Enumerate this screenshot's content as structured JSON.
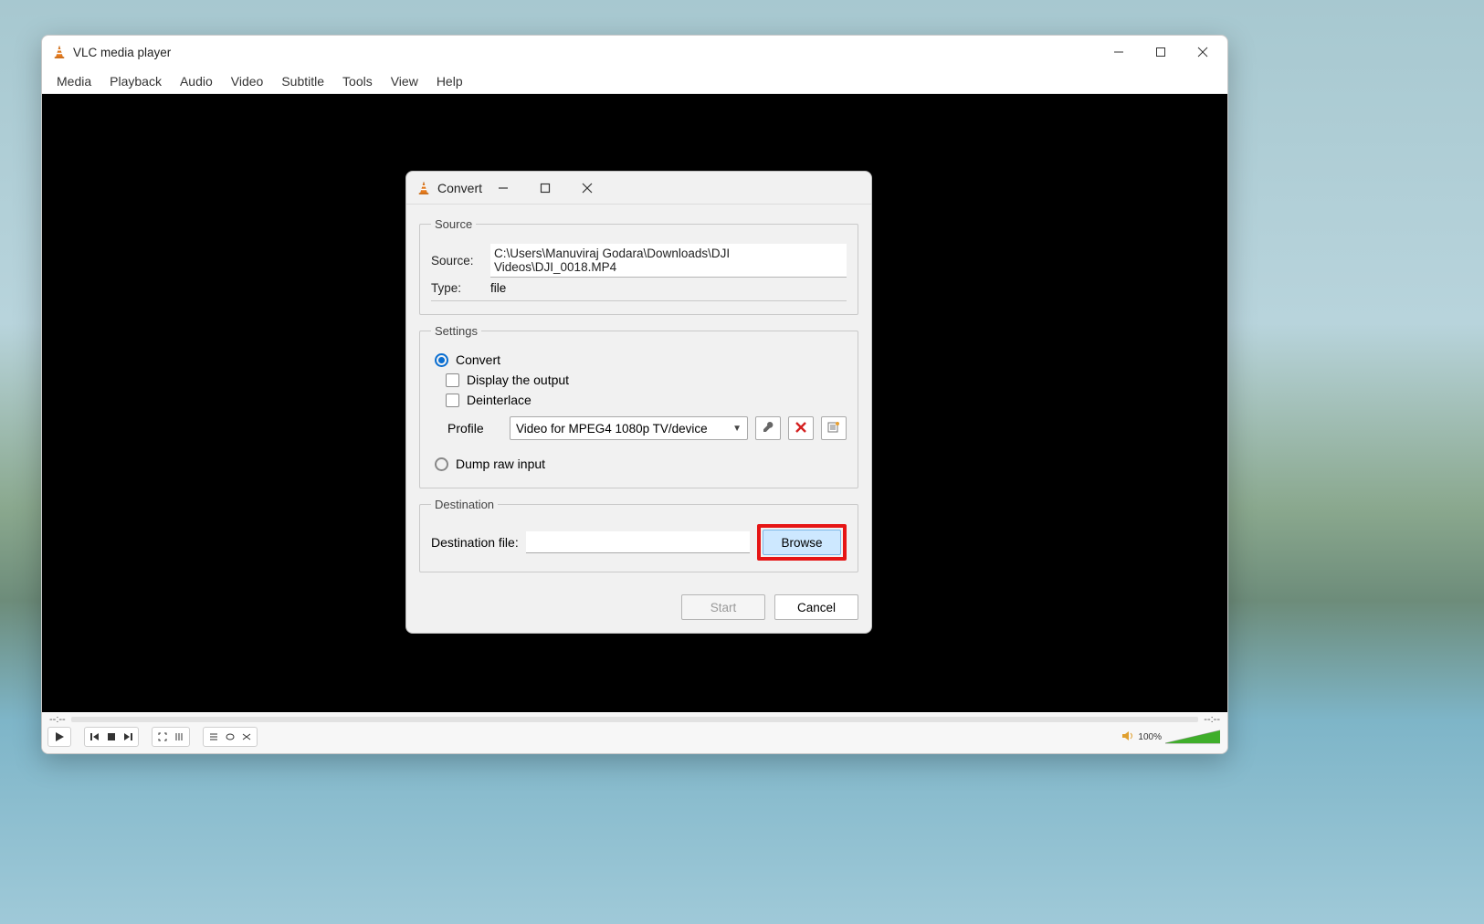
{
  "main": {
    "app_title": "VLC media player",
    "menu": [
      "Media",
      "Playback",
      "Audio",
      "Video",
      "Subtitle",
      "Tools",
      "View",
      "Help"
    ],
    "time_left": "--:--",
    "time_right": "--:--",
    "volume_label": "100%"
  },
  "dialog": {
    "title": "Convert",
    "source": {
      "legend": "Source",
      "source_label": "Source:",
      "source_value": "C:\\Users\\Manuviraj Godara\\Downloads\\DJI Videos\\DJI_0018.MP4",
      "type_label": "Type:",
      "type_value": "file"
    },
    "settings": {
      "legend": "Settings",
      "convert_label": "Convert",
      "display_output_label": "Display the output",
      "deinterlace_label": "Deinterlace",
      "profile_label": "Profile",
      "profile_value": "Video for MPEG4 1080p TV/device",
      "dump_label": "Dump raw input"
    },
    "destination": {
      "legend": "Destination",
      "dest_label": "Destination file:",
      "browse_label": "Browse"
    },
    "buttons": {
      "start": "Start",
      "cancel": "Cancel"
    }
  }
}
